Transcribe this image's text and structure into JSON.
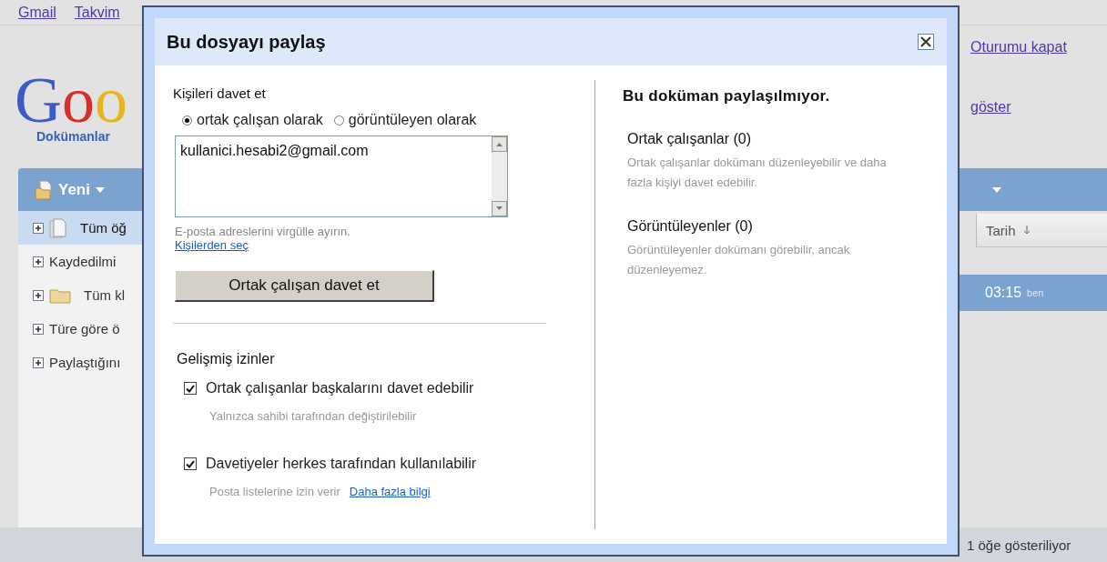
{
  "top_links": [
    {
      "label": "Gmail"
    },
    {
      "label": "Takvim"
    }
  ],
  "sign_out": "Oturumu kapat",
  "logo": {
    "letters": [
      {
        "char": "G",
        "color": "#3b5cc4"
      },
      {
        "char": "o",
        "color": "#d3302c"
      },
      {
        "char": "o",
        "color": "#e9b51c"
      }
    ],
    "product": "Dokümanlar"
  },
  "show_link": "göster",
  "toolbar": {
    "new_button": "Yeni"
  },
  "sidebar": {
    "items": [
      {
        "label": "Tüm öğ",
        "kind": "documents",
        "selected": true
      },
      {
        "label": "Kaydedilmi",
        "kind": "plain",
        "selected": false
      },
      {
        "label": "Tüm kl",
        "kind": "folder",
        "selected": false
      },
      {
        "label": "Türe göre ö",
        "kind": "plain",
        "selected": false
      },
      {
        "label": "Paylaştığını",
        "kind": "plain",
        "selected": false
      }
    ]
  },
  "list": {
    "columns": [
      {
        "label": "Tarih"
      }
    ],
    "rows": [
      {
        "time": "03:15",
        "owner": "ben",
        "selected": true
      }
    ]
  },
  "status_bar": "1 öğe gösteriliyor",
  "dialog": {
    "title": "Bu dosyayı paylaş",
    "invite": {
      "heading": "Kişileri davet et",
      "roles": [
        {
          "label": "ortak çalışan olarak",
          "selected": true
        },
        {
          "label": "görüntüleyen olarak",
          "selected": false
        }
      ],
      "emails": {
        "value": "kullanici.hesabi2@gmail.com"
      },
      "hint": "E-posta adreslerini virgülle ayırın.",
      "contacts_link": "Kişilerden seç",
      "submit": "Ortak çalışan davet et"
    },
    "advanced": {
      "heading": "Gelişmiş izinler",
      "options": [
        {
          "label": "Ortak çalışanlar başkalarını davet edebilir",
          "checked": true,
          "note": "Yalnızca sahibi tarafından değiştirilebilir"
        },
        {
          "label": "Davetiyeler herkes tarafından kullanılabilir",
          "checked": true,
          "note": "Posta listelerine izin verir",
          "link": "Daha fazla bilgi"
        }
      ]
    },
    "sharing": {
      "heading": "Bu doküman paylaşılmıyor.",
      "groups": [
        {
          "title": "Ortak çalışanlar (0)",
          "description": "Ortak çalışanlar dokümanı düzenleyebilir ve daha fazla kişiyi davet edebilir."
        },
        {
          "title": "Görüntüleyenler (0)",
          "description": "Görüntüleyenler dokümanı görebilir, ancak düzenleyemez."
        }
      ]
    }
  }
}
